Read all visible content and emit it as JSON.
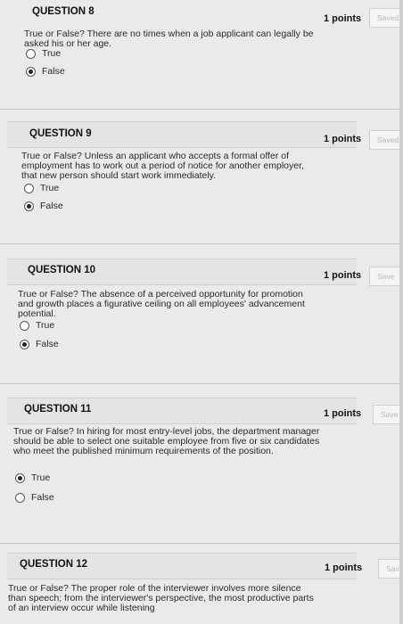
{
  "questions": [
    {
      "title": "QUESTION 8",
      "points": "1 points",
      "save_label": "Saved",
      "text": "True or False? There are no times when a job applicant can legally be asked his or her age.",
      "options": [
        {
          "label": "True",
          "selected": false
        },
        {
          "label": "False",
          "selected": true
        }
      ]
    },
    {
      "title": "QUESTION 9",
      "points": "1 points",
      "save_label": "Saved",
      "text": "True or False? Unless an applicant who accepts a formal offer of employment has to work out a period of notice for another employer, that new person should start work immediately.",
      "options": [
        {
          "label": "True",
          "selected": false
        },
        {
          "label": "False",
          "selected": true
        }
      ]
    },
    {
      "title": "QUESTION 10",
      "points": "1 points",
      "save_label": "Save",
      "text": "True or False? The absence of a perceived opportunity for promotion and growth places a figurative ceiling on all employees' advancement potential.",
      "options": [
        {
          "label": "True",
          "selected": false
        },
        {
          "label": "False",
          "selected": true
        }
      ]
    },
    {
      "title": "QUESTION 11",
      "points": "1 points",
      "save_label": "Save",
      "text": "True or False? In hiring for most entry-level jobs, the department manager should be able to select one suitable employee from five or six candidates who meet the published minimum requirements of the position.",
      "options": [
        {
          "label": "True",
          "selected": true
        },
        {
          "label": "False",
          "selected": false
        }
      ]
    },
    {
      "title": "QUESTION 12",
      "points": "1 points",
      "save_label": "Sav",
      "text": "True or False? The proper role of the interviewer involves more silence than speech; from the interviewer's perspective, the most productive parts of an interview occur while listening",
      "options": []
    }
  ]
}
